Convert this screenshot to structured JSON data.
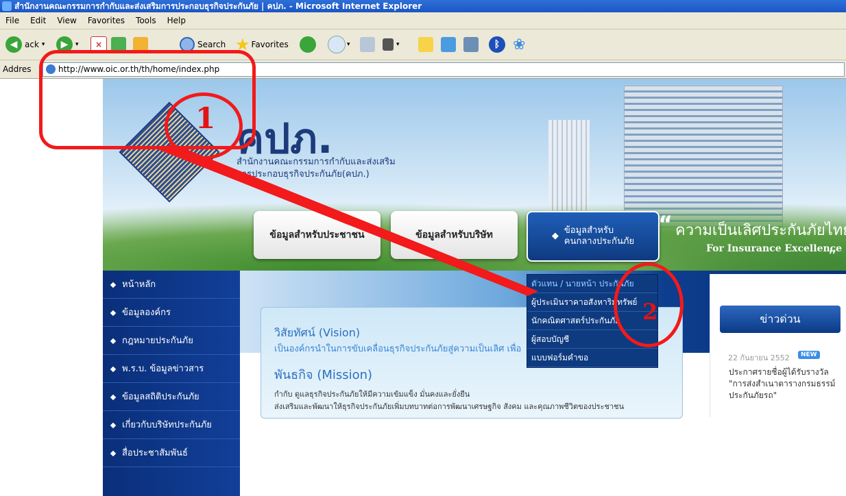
{
  "window": {
    "title": "สำนักงานคณะกรรมการกำกับและส่งเสริมการประกอบธุรกิจประกันภัย | คปภ. - Microsoft Internet Explorer"
  },
  "menu": [
    "File",
    "Edit",
    "View",
    "Favorites",
    "Tools",
    "Help"
  ],
  "toolbar": {
    "back_label": "ack",
    "search_label": "Search",
    "favorites_label": "Favorites"
  },
  "address": {
    "label": "Addres",
    "url": "http://www.oic.or.th/th/home/index.php"
  },
  "header": {
    "logo_text": "คปภ.",
    "org_line_1": "สำนักงานคณะกรรมการกำกับและส่งเสริม",
    "org_line_2": "การประกอบธุรกิจประกันภัย(คปภ.)"
  },
  "nav": {
    "items": [
      "หน้าหลัก",
      "ข้อมูลองค์กร",
      "กฎหมายประกันภัย",
      "พ.ร.บ. ข้อมูลข่าวสาร",
      "ข้อมูลสถิติประกันภัย",
      "เกี่ยวกับบริษัทประกันภัย",
      "สื่อประชาสัมพันธ์"
    ]
  },
  "buttons": {
    "public": "ข้อมูลสำหรับประชาชน",
    "company": "ข้อมูลสำหรับบริษัท",
    "intermediary_1": "ข้อมูลสำหรับ",
    "intermediary_2": "คนกลางประกันภัย"
  },
  "slogan": {
    "th": "ความเป็นเลิศประกันภัยไทย",
    "en": "For Insurance Excellence",
    "quote_open": "“",
    "quote_close": "”"
  },
  "dropdown": {
    "items": [
      "ตัวแทน / นายหน้า ประกันภัย",
      "ผู้ประเมินราคาอสังหาริมทรัพย์",
      "นักคณิตศาสตร์ประกันภัย",
      "ผู้สอบบัญชี",
      "แบบฟอร์มคำขอ"
    ]
  },
  "content": {
    "vision_heading": "วิสัยทัศน์ (Vision)",
    "vision_text": "เป็นองค์กรนำในการขับเคลื่อนธุรกิจประกันภัยสู่ความเป็นเลิศ เพื่อ",
    "mission_heading": "พันธกิจ (Mission)",
    "mission_line_1": "กำกับ ดูแลธุรกิจประกันภัยให้มีความเข้มแข็ง มั่นคงและยั่งยืน",
    "mission_line_2": "ส่งเสริมและพัฒนาให้ธุรกิจประกันภัยเพิ่มบทบาทต่อการพัฒนาเศรษฐกิจ สังคม และคุณภาพชีวิตของประชาชน"
  },
  "news": {
    "heading": "ข่าวด่วน",
    "date": "22 กันยายน 2552",
    "badge": "NEW",
    "text": "ประกาศรายชื่อผู้ได้รับรางวัล \"การส่งสำเนาตารางกรมธรรม์ประกันภัยรถ\""
  },
  "annotations": {
    "label_1": "1",
    "label_2": "2"
  },
  "colors": {
    "annotation_red": "#f21a1a",
    "nav_blue": "#0a2f7a"
  }
}
